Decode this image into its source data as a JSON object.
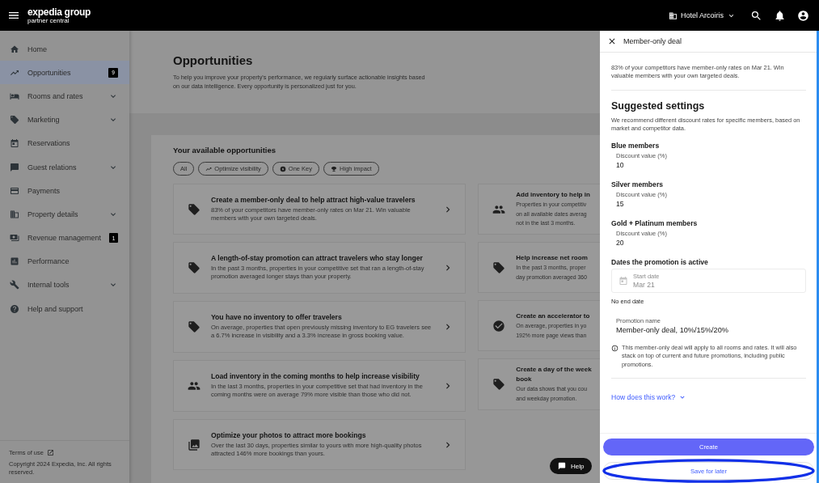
{
  "topbar": {
    "brand": "expedia group",
    "subbrand": "partner central",
    "property": "Hotel Arcoiris"
  },
  "sidebar": {
    "items": [
      {
        "label": "Home",
        "kind": "link",
        "selected": false
      },
      {
        "label": "Opportunities",
        "kind": "link",
        "selected": true,
        "badge": "9"
      },
      {
        "label": "Rooms and rates",
        "kind": "group",
        "selected": false
      },
      {
        "label": "Marketing",
        "kind": "group",
        "selected": false
      },
      {
        "label": "Reservations",
        "kind": "link",
        "selected": false
      },
      {
        "label": "Guest relations",
        "kind": "group",
        "selected": false
      },
      {
        "label": "Payments",
        "kind": "link",
        "selected": false
      },
      {
        "label": "Property details",
        "kind": "group",
        "selected": false
      },
      {
        "label": "Revenue management",
        "kind": "link",
        "selected": false,
        "badge": "1"
      },
      {
        "label": "Performance",
        "kind": "link",
        "selected": false
      },
      {
        "label": "Internal tools",
        "kind": "group",
        "selected": false
      },
      {
        "label": "Help and support",
        "kind": "link",
        "selected": false
      }
    ],
    "footer": {
      "terms": "Terms of use",
      "copyright": "Copyright 2024 Expedia, Inc. All rights reserved."
    }
  },
  "page": {
    "title": "Opportunities",
    "description": "To help you improve your property's performance, we regularly surface actionable insights based on our data intelligence. Every opportunity is personalized just for you."
  },
  "opportunities": {
    "heading": "Your available opportunities",
    "filters": [
      "All",
      "Optimize visibility",
      "One Key",
      "High impact"
    ],
    "cards": [
      {
        "title": "Create a member-only deal to help attract high-value travelers",
        "description": "83% of your competitors have member-only rates on Mar 21. Win valuable members with your own targeted deals."
      },
      {
        "title": "A length-of-stay promotion can attract travelers who stay longer",
        "description": "In the past 3 months, properties in your competitive set that ran a length-of-stay promotion averaged longer stays than your property."
      },
      {
        "title": "You have no inventory to offer travelers",
        "description": "On average, properties that open previously missing inventory to EG travelers see a 6.7% increase in visibility and a 3.3% increase in gross booking value."
      },
      {
        "title": "Load inventory in the coming months to help increase visibility",
        "description": "In the last 3 months, properties in your competitive set that had inventory in the coming months were on average 79% more visible than those who did not."
      },
      {
        "title": "Optimize your photos to attract more bookings",
        "description": "Over the last 30 days, properties similar to yours with more high-quality photos attracted 146% more bookings than yours."
      }
    ],
    "cut_cards": [
      {
        "title_lines": [
          "Add inventory to help in"
        ],
        "lines": [
          "Properties in your competitiv",
          "on all available dates averag",
          "not in the last 3 months."
        ]
      },
      {
        "title_lines": [
          "Help increase net room"
        ],
        "lines": [
          "In the past 3 months, proper",
          "day promotion averaged 360"
        ]
      },
      {
        "title_lines": [
          "Create an accelerator to"
        ],
        "lines": [
          "On average, properties in yo",
          "192% more page views than"
        ]
      },
      {
        "title_lines": [
          "Create a day of the week",
          "book"
        ],
        "lines": [
          "Our data shows that you cou",
          "and weekday promotion."
        ]
      }
    ]
  },
  "help_button": "Help",
  "drawer": {
    "title": "Member-only deal",
    "intro": "83% of your competitors have member-only rates on Mar 21. Win valuable members with your own targeted deals.",
    "heading": "Suggested settings",
    "subtext": "We recommend different discount rates for specific members, based on market and competitor data.",
    "tiers": [
      {
        "name": "Blue members",
        "field_label": "Discount value (%)",
        "value": "10"
      },
      {
        "name": "Silver members",
        "field_label": "Discount value (%)",
        "value": "15"
      },
      {
        "name": "Gold + Platinum members",
        "field_label": "Discount value (%)",
        "value": "20"
      }
    ],
    "dates_heading": "Dates the promotion is active",
    "start_date": {
      "label": "Start date",
      "value": "Mar 21",
      "disabled": true
    },
    "end_date": "No end date",
    "promotion_name": {
      "label": "Promotion name",
      "value": "Member-only deal, 10%/15%/20%"
    },
    "note": "This member-only deal will apply to all rooms and rates. It will also stack on top of current and future promotions, including public promotions.",
    "link": "How does this work?",
    "primary_button": "Create",
    "secondary_button": "Save for later",
    "secondary_highlighted": true
  }
}
